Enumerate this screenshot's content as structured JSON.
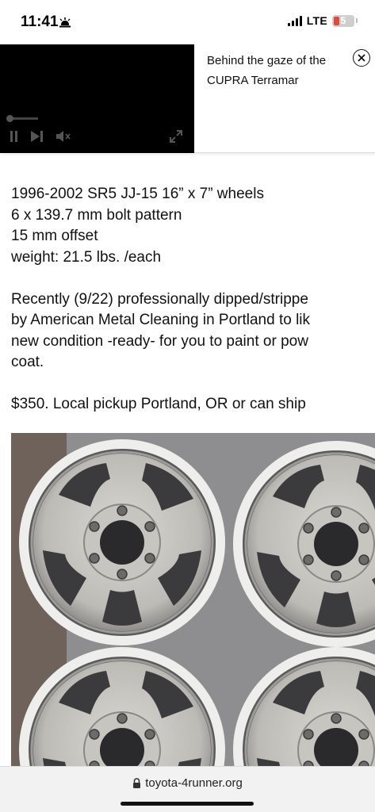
{
  "status_bar": {
    "time": "11:41",
    "network": "LTE",
    "battery_level": "5"
  },
  "ad": {
    "headline": "Behind the gaze of the CUPRA Terramar",
    "video_progress": 0.05
  },
  "listing": {
    "spec_lines": [
      "1996-2002 SR5 JJ-15 16” x 7” wheels",
      "6 x 139.7 mm bolt pattern",
      "15 mm offset",
      "weight: 21.5 lbs. /each"
    ],
    "description_lines": [
      "Recently (9/22) professionally dipped/strippe",
      "by American Metal Cleaning in Portland to lik",
      "new condition -ready- for you to paint or pow",
      "coat."
    ],
    "price_line": "$350. Local pickup Portland, OR or can ship"
  },
  "photo": {
    "subject": "four silver steel wheels"
  },
  "browser": {
    "url": "toyota-4runner.org"
  },
  "icons": {
    "alarm": "alarm-icon",
    "lock": "lock-icon",
    "close": "close-icon",
    "play_pause": "pause-icon",
    "skip": "skip-icon",
    "mute": "mute-icon",
    "expand": "expand-icon"
  }
}
